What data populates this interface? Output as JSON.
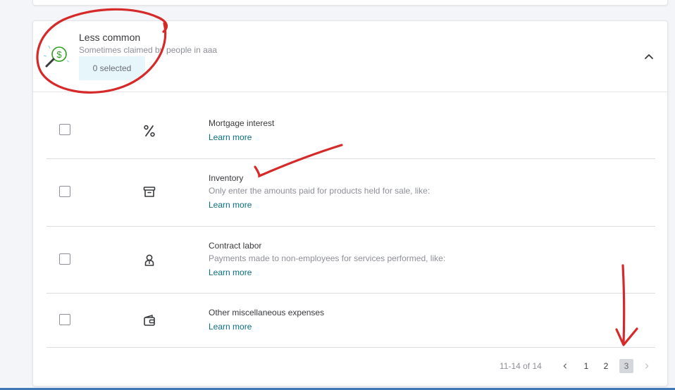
{
  "section": {
    "title": "Less common",
    "subtitle": "Sometimes claimed by people in aaa",
    "selected_label": "0 selected",
    "icon": "magnifier-dollar-icon",
    "collapse_icon": "chevron-up-icon"
  },
  "items": [
    {
      "title": "Mortgage interest",
      "description": "",
      "link": "Learn more",
      "icon": "percent-icon"
    },
    {
      "title": "Inventory",
      "description": "Only enter the amounts paid for products held for sale, like:",
      "link": "Learn more",
      "icon": "archive-box-icon"
    },
    {
      "title": "Contract labor",
      "description": "Payments made to non-employees for services performed, like:",
      "link": "Learn more",
      "icon": "worker-icon"
    },
    {
      "title": "Other miscellaneous expenses",
      "description": "",
      "link": "Learn more",
      "icon": "wallet-icon"
    }
  ],
  "pagination": {
    "range_text": "11-14 of 14",
    "pages": [
      "1",
      "2",
      "3"
    ],
    "current_page": "3",
    "prev_icon": "chevron-left-icon",
    "next_icon": "chevron-right-icon"
  },
  "colors": {
    "link": "#0b6f84",
    "chip_bg": "#e6f6fb",
    "annotation": "#d62a2a",
    "icon_accent": "#2ca01c"
  }
}
